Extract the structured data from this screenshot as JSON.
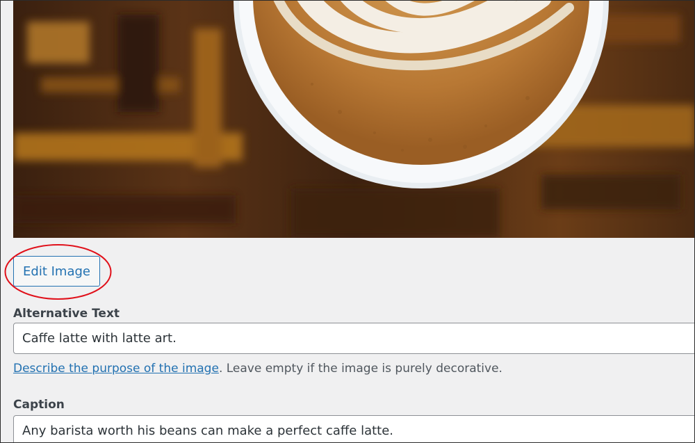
{
  "attachment": {
    "edit_image_label": "Edit Image",
    "alt_text": {
      "label": "Alternative Text",
      "value": "Caffe latte with latte art.",
      "help_link": "Describe the purpose of the image",
      "help_rest": ". Leave empty if the image is purely decorative."
    },
    "caption": {
      "label": "Caption",
      "value": "Any barista worth his beans can make a perfect caffe latte."
    }
  },
  "colors": {
    "accent": "#2271b1",
    "highlight_ring": "#e0101a",
    "background": "#f0f0f1"
  },
  "icons": [
    "latte-art-photo"
  ]
}
